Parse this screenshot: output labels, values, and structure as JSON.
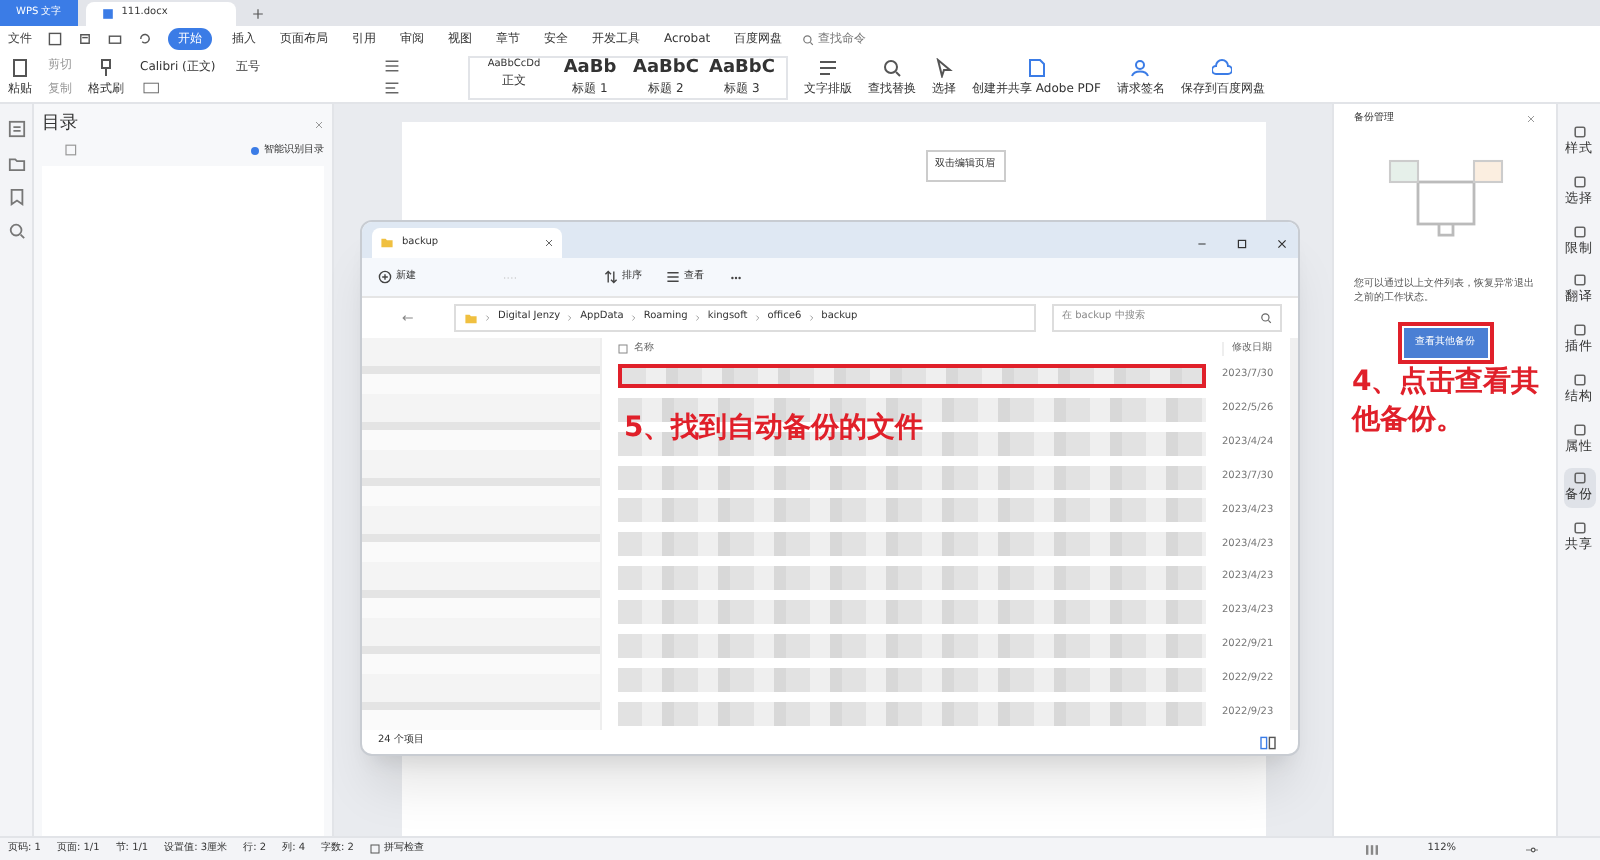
{
  "app_tabs": [
    {
      "label": "WPS 文字",
      "selected": false
    },
    {
      "label": "111.docx",
      "selected": true
    }
  ],
  "menu": {
    "file": "文件",
    "tabs": [
      {
        "label": "开始",
        "selected": true
      },
      {
        "label": "插入",
        "selected": false
      },
      {
        "label": "页面布局",
        "selected": false
      },
      {
        "label": "引用",
        "selected": false
      },
      {
        "label": "审阅",
        "selected": false
      },
      {
        "label": "视图",
        "selected": false
      },
      {
        "label": "章节",
        "selected": false
      },
      {
        "label": "安全",
        "selected": false
      },
      {
        "label": "开发工具",
        "selected": false
      },
      {
        "label": "Acrobat",
        "selected": false
      },
      {
        "label": "百度网盘",
        "selected": false
      }
    ],
    "search": "查找命令"
  },
  "ribbon": {
    "paste": "粘贴",
    "cut": "剪切",
    "copy": "复制",
    "format_painter": "格式刷",
    "font": "Calibri (正文)",
    "size": "五号",
    "styles": [
      {
        "sample": "AaBbCcDd",
        "label": "正文"
      },
      {
        "sample": "AaBb",
        "label": "标题 1"
      },
      {
        "sample": "AaBbC",
        "label": "标题 2"
      },
      {
        "sample": "AaBbC",
        "label": "标题 3"
      }
    ],
    "tools": [
      {
        "label": "文字排版"
      },
      {
        "label": "查找替换"
      },
      {
        "label": "选择"
      },
      {
        "label": "创建并共享 Adobe PDF"
      },
      {
        "label": "请求签名"
      },
      {
        "label": "保存到百度网盘"
      }
    ]
  },
  "outline_panel": {
    "title": "目录",
    "smart": "智能识别目录"
  },
  "page": {
    "header_hint": "双击编辑页眉"
  },
  "backup_panel": {
    "title": "备份管理",
    "description": "您可以通过以上文件列表，恢复异常退出之前的工作状态。",
    "button": "查看其他备份",
    "annotation": "4、点击查看其他备份。"
  },
  "right_rail": [
    {
      "label": "样式",
      "selected": false
    },
    {
      "label": "选择",
      "selected": false
    },
    {
      "label": "限制",
      "selected": false
    },
    {
      "label": "翻译",
      "selected": false
    },
    {
      "label": "插件",
      "selected": false
    },
    {
      "label": "结构",
      "selected": false
    },
    {
      "label": "属性",
      "selected": false
    },
    {
      "label": "备份",
      "selected": true
    },
    {
      "label": "共享",
      "selected": false
    }
  ],
  "explorer": {
    "tab": "backup",
    "new": "新建",
    "sort": "排序",
    "view": "查看",
    "path": [
      "Digital Jenzy",
      "AppData",
      "Roaming",
      "kingsoft",
      "office6",
      "backup"
    ],
    "search": "在 backup 中搜索",
    "columns": [
      "名称",
      "修改日期"
    ],
    "annotation": "5、找到自动备份的文件",
    "rows": [
      {
        "date": "2023/7/30",
        "highlighted": true
      },
      {
        "date": "2022/5/26",
        "highlighted": false
      },
      {
        "date": "2023/4/24",
        "highlighted": false
      },
      {
        "date": "2023/7/30",
        "highlighted": false
      },
      {
        "date": "2023/4/23",
        "highlighted": false
      },
      {
        "date": "2023/4/23",
        "highlighted": false
      },
      {
        "date": "2023/4/23",
        "highlighted": false
      },
      {
        "date": "2023/4/23",
        "highlighted": false
      },
      {
        "date": "2022/9/21",
        "highlighted": false
      },
      {
        "date": "2022/9/22",
        "highlighted": false
      },
      {
        "date": "2022/9/23",
        "highlighted": false
      }
    ],
    "count": "24 个项目"
  },
  "status_bar": {
    "items": [
      "页码: 1",
      "页面: 1/1",
      "节: 1/1",
      "设置值: 3厘米",
      "行: 2",
      "列: 4",
      "字数: 2"
    ],
    "spell": "拼写检查",
    "zoom": "112%"
  }
}
